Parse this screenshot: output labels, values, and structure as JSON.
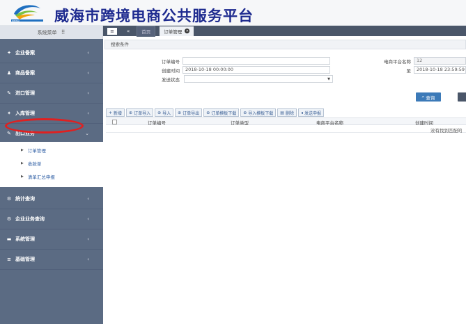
{
  "header": {
    "title": "威海市跨境电商公共服务平台",
    "logo_text": "WEIHAI"
  },
  "sidebar": {
    "menu_title": "系统菜单",
    "items": [
      {
        "label": "企业备案",
        "icon": "star-icon"
      },
      {
        "label": "商品备案",
        "icon": "user-icon"
      },
      {
        "label": "进口管理",
        "icon": "tools-icon"
      },
      {
        "label": "入库管理",
        "icon": "star-icon"
      },
      {
        "label": "出口业务",
        "icon": "tools-icon"
      },
      {
        "label": "统计查询",
        "icon": "gears-icon"
      },
      {
        "label": "企业业务查询",
        "icon": "gears-icon"
      },
      {
        "label": "系统管理",
        "icon": "window-icon"
      },
      {
        "label": "基础管理",
        "icon": "list-icon"
      }
    ],
    "submenu": [
      {
        "label": "订单管理"
      },
      {
        "label": "收款单"
      },
      {
        "label": "清单汇总申报"
      }
    ]
  },
  "tabs": {
    "home": "首页",
    "active": "订单管理"
  },
  "search": {
    "section_title": "搜索条件",
    "order_no_label": "订单编号",
    "order_no_value": "",
    "created_label": "创建时间",
    "created_from": "2018-10-18 00:00:00",
    "to_label": "至",
    "created_to": "2018-10-18 23:59:59",
    "send_status_label": "发送状态",
    "send_status_value": "",
    "platform_label": "电商平台名称",
    "platform_value": "12",
    "query_button": "查询"
  },
  "toolbar": [
    {
      "label": "新增",
      "icon": "+"
    },
    {
      "label": "订单导入",
      "icon": "⊕"
    },
    {
      "label": "导入",
      "icon": "⊕"
    },
    {
      "label": "订单导出",
      "icon": "⊕"
    },
    {
      "label": "订单模板下载",
      "icon": "⊕"
    },
    {
      "label": "导入模板下载",
      "icon": "⊕"
    },
    {
      "label": "删除",
      "icon": "▤"
    },
    {
      "label": "发送申报",
      "icon": "◂"
    }
  ],
  "table": {
    "columns": [
      "订单编号",
      "订单类型",
      "电商平台名称",
      "创建时间"
    ],
    "empty_message": "没有找到匹配的"
  },
  "colors": {
    "sidebar_bg": "#5b6b83",
    "tabbar_bg": "#4a5669",
    "title_color": "#1d2a8f",
    "accent": "#3c7ab8",
    "highlight_oval": "#e02020"
  }
}
